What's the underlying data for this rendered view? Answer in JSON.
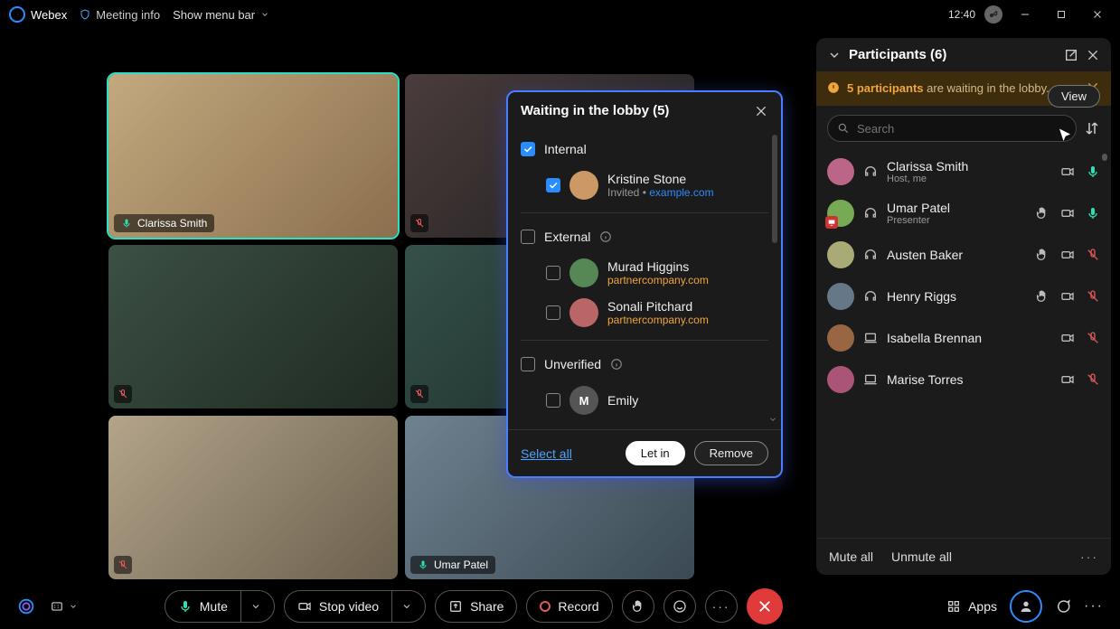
{
  "titlebar": {
    "app": "Webex",
    "meeting_info": "Meeting info",
    "menu": "Show menu bar",
    "time": "12:40"
  },
  "grid": {
    "tiles": [
      {
        "name": "Clarissa Smith",
        "mic": "on"
      },
      {
        "name": "",
        "mic": "off"
      },
      {
        "name": "",
        "mic": "off"
      },
      {
        "name": "",
        "mic": "off"
      },
      {
        "name": "",
        "mic": "off"
      },
      {
        "name": "Umar Patel",
        "mic": "on"
      }
    ]
  },
  "lobby": {
    "title": "Waiting in the lobby (5)",
    "groups": {
      "internal": "Internal",
      "external": "External",
      "unverified": "Unverified"
    },
    "invited_label": "Invited",
    "entries": {
      "internal": [
        {
          "name": "Kristine Stone",
          "domain": "example.com",
          "invited": true
        }
      ],
      "external": [
        {
          "name": "Murad Higgins",
          "domain": "partnercompany.com"
        },
        {
          "name": "Sonali Pitchard",
          "domain": "partnercompany.com"
        }
      ],
      "unverified": [
        {
          "name": "Emily",
          "initial": "M"
        }
      ]
    },
    "select_all": "Select all",
    "let_in": "Let in",
    "remove": "Remove"
  },
  "participants": {
    "title": "Participants (6)",
    "banner": {
      "highlight": "5 participants",
      "rest": " are waiting in the lobby.",
      "view": "View"
    },
    "search_placeholder": "Search",
    "list": [
      {
        "name": "Clarissa Smith",
        "sub": "Host, me",
        "device": "headset",
        "mic": "on",
        "cam": true,
        "hand": false
      },
      {
        "name": "Umar Patel",
        "sub": "Presenter",
        "device": "headset",
        "mic": "on",
        "cam": true,
        "hand": true
      },
      {
        "name": "Austen Baker",
        "sub": "",
        "device": "headset",
        "mic": "off",
        "cam": true,
        "hand": true
      },
      {
        "name": "Henry Riggs",
        "sub": "",
        "device": "headset",
        "mic": "off",
        "cam": true,
        "hand": true
      },
      {
        "name": "Isabella Brennan",
        "sub": "",
        "device": "laptop",
        "mic": "off",
        "cam": true,
        "hand": false
      },
      {
        "name": "Marise Torres",
        "sub": "",
        "device": "laptop",
        "mic": "off",
        "cam": true,
        "hand": false
      }
    ],
    "mute_all": "Mute all",
    "unmute_all": "Unmute all"
  },
  "controls": {
    "mute": "Mute",
    "stop_video": "Stop video",
    "share": "Share",
    "record": "Record",
    "apps": "Apps"
  }
}
